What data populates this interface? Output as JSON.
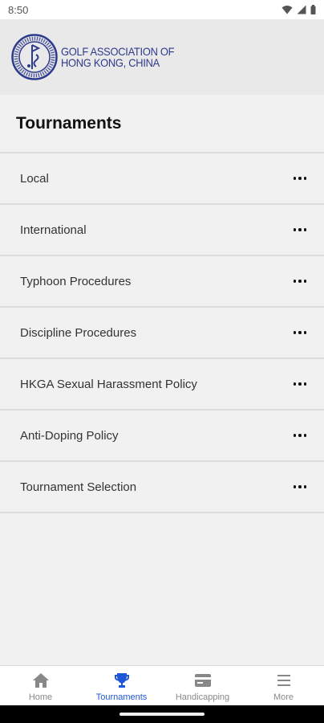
{
  "status_bar": {
    "time": "8:50"
  },
  "header": {
    "logo_line1": "GOLF ASSOCIATION OF",
    "logo_line2": "HONG KONG, CHINA"
  },
  "page": {
    "title": "Tournaments"
  },
  "list": {
    "items": [
      {
        "label": "Local"
      },
      {
        "label": "International"
      },
      {
        "label": "Typhoon Procedures"
      },
      {
        "label": "Discipline Procedures"
      },
      {
        "label": "HKGA Sexual Harassment Policy"
      },
      {
        "label": "Anti-Doping Policy"
      },
      {
        "label": "Tournament Selection"
      }
    ]
  },
  "tabs": [
    {
      "label": "Home",
      "icon": "home-icon",
      "active": false
    },
    {
      "label": "Tournaments",
      "icon": "trophy-icon",
      "active": true
    },
    {
      "label": "Handicapping",
      "icon": "card-icon",
      "active": false
    },
    {
      "label": "More",
      "icon": "menu-icon",
      "active": false
    }
  ],
  "colors": {
    "accent": "#1e56d6",
    "logo": "#2e3a8c",
    "background": "#f1f1f1"
  }
}
